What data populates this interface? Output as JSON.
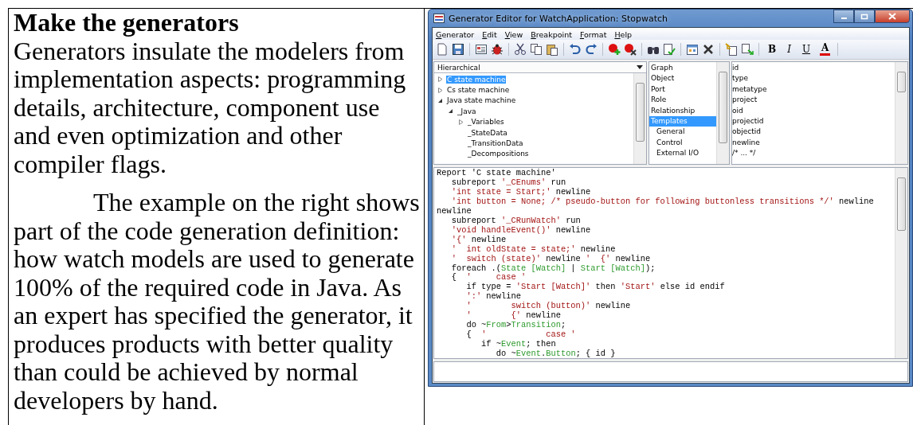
{
  "document": {
    "heading": "Make the generators",
    "paragraphs": [
      "Generators insulate the modelers from implementation aspects: programming details, architecture, component use and even optimization and other compiler flags.",
      "The example on the right shows part of the code generation definition: how watch models are used to generate 100% of the required code in Java. As an expert has specified the generator, it produces products with better quality than could be achieved by normal developers by hand."
    ]
  },
  "window": {
    "title": "Generator Editor for WatchApplication: Stopwatch"
  },
  "menu": [
    "Generator",
    "Edit",
    "View",
    "Breakpoint",
    "Format",
    "Help"
  ],
  "format_buttons": [
    {
      "label": "B",
      "kind": "bold"
    },
    {
      "label": "I",
      "kind": "italic"
    },
    {
      "label": "U",
      "kind": "underline"
    },
    {
      "label": "A",
      "kind": "color"
    }
  ],
  "tree_view": {
    "mode": "Hierarchical",
    "items": [
      {
        "label": "C state machine",
        "selected": true,
        "expanded": false
      },
      {
        "label": "Cs state machine",
        "selected": false,
        "expanded": false
      },
      {
        "label": "Java state machine",
        "selected": false,
        "expanded": true,
        "children": [
          {
            "label": "_Java",
            "selected": false,
            "expanded": true,
            "children": [
              {
                "label": "_Variables",
                "selected": false,
                "expanded": false
              },
              {
                "label": "_StateData",
                "selected": false
              },
              {
                "label": "_TransitionData",
                "selected": false
              },
              {
                "label": "_Decompositions",
                "selected": false
              }
            ]
          }
        ]
      }
    ]
  },
  "type_list": [
    {
      "label": "Graph",
      "selected": false
    },
    {
      "label": "Object",
      "selected": false
    },
    {
      "label": "Port",
      "selected": false
    },
    {
      "label": "Role",
      "selected": false
    },
    {
      "label": "Relationship",
      "selected": false
    },
    {
      "label": "Templates",
      "selected": true,
      "children": [
        {
          "label": "General",
          "selected": false
        },
        {
          "label": "Control",
          "selected": false
        },
        {
          "label": "External I/O",
          "selected": false
        }
      ]
    }
  ],
  "keyword_list": [
    "id",
    "type",
    "metatype",
    "project",
    "oid",
    "projectid",
    "objectid",
    "newline",
    "/* ... */"
  ],
  "code": [
    [
      {
        "kind": "plain",
        "text": "Report 'C state machine'"
      }
    ],
    [
      {
        "kind": "plain",
        "text": "   subreport "
      },
      {
        "kind": "string",
        "text": "'_CEnums'"
      },
      {
        "kind": "plain",
        "text": " run"
      }
    ],
    [
      {
        "kind": "string",
        "text": "   'int state = Start;'"
      },
      {
        "kind": "plain",
        "text": " newline"
      }
    ],
    [
      {
        "kind": "string",
        "text": "   'int button = None; /* pseudo-button for following buttonless transitions */'"
      },
      {
        "kind": "plain",
        "text": " newline"
      }
    ],
    [
      {
        "kind": "plain",
        "text": "newline"
      }
    ],
    [
      {
        "kind": "plain",
        "text": "   subreport "
      },
      {
        "kind": "string",
        "text": "'_CRunWatch'"
      },
      {
        "kind": "plain",
        "text": " run"
      }
    ],
    [
      {
        "kind": "string",
        "text": "   'void handleEvent()'"
      },
      {
        "kind": "plain",
        "text": " newline"
      }
    ],
    [
      {
        "kind": "string",
        "text": "   '{'"
      },
      {
        "kind": "plain",
        "text": " newline"
      }
    ],
    [
      {
        "kind": "string",
        "text": "   '  int oldState = state;'"
      },
      {
        "kind": "plain",
        "text": " newline"
      }
    ],
    [
      {
        "kind": "string",
        "text": "   '  switch (state)'"
      },
      {
        "kind": "plain",
        "text": " newline "
      },
      {
        "kind": "string",
        "text": "'  {'"
      },
      {
        "kind": "plain",
        "text": " newline"
      }
    ],
    [
      {
        "kind": "plain",
        "text": "   foreach .("
      },
      {
        "kind": "ident",
        "text": "State [Watch]"
      },
      {
        "kind": "plain",
        "text": " | "
      },
      {
        "kind": "ident",
        "text": "Start [Watch]"
      },
      {
        "kind": "plain",
        "text": ");"
      }
    ],
    [
      {
        "kind": "plain",
        "text": "   {  "
      },
      {
        "kind": "string",
        "text": "'     case '"
      }
    ],
    [
      {
        "kind": "plain",
        "text": "      if type = "
      },
      {
        "kind": "string",
        "text": "'Start [Watch]'"
      },
      {
        "kind": "plain",
        "text": " then "
      },
      {
        "kind": "string",
        "text": "'Start'"
      },
      {
        "kind": "plain",
        "text": " else id endif"
      }
    ],
    [
      {
        "kind": "string",
        "text": "      ':'"
      },
      {
        "kind": "plain",
        "text": " newline"
      }
    ],
    [
      {
        "kind": "string",
        "text": "      '        switch (button)'"
      },
      {
        "kind": "plain",
        "text": " newline"
      }
    ],
    [
      {
        "kind": "string",
        "text": "      '        {'"
      },
      {
        "kind": "plain",
        "text": " newline"
      }
    ],
    [
      {
        "kind": "plain",
        "text": "      do ~"
      },
      {
        "kind": "ident",
        "text": "From"
      },
      {
        "kind": "plain",
        "text": ">"
      },
      {
        "kind": "ident",
        "text": "Transition"
      },
      {
        "kind": "plain",
        "text": ";"
      }
    ],
    [
      {
        "kind": "plain",
        "text": "      {  "
      },
      {
        "kind": "string",
        "text": "'            case '"
      }
    ],
    [
      {
        "kind": "plain",
        "text": "         if ~"
      },
      {
        "kind": "ident",
        "text": "Event"
      },
      {
        "kind": "plain",
        "text": "; then"
      }
    ],
    [
      {
        "kind": "plain",
        "text": "            do ~"
      },
      {
        "kind": "ident",
        "text": "Event"
      },
      {
        "kind": "plain",
        "text": "."
      },
      {
        "kind": "ident",
        "text": "Button"
      },
      {
        "kind": "plain",
        "text": "; { id }"
      }
    ]
  ]
}
